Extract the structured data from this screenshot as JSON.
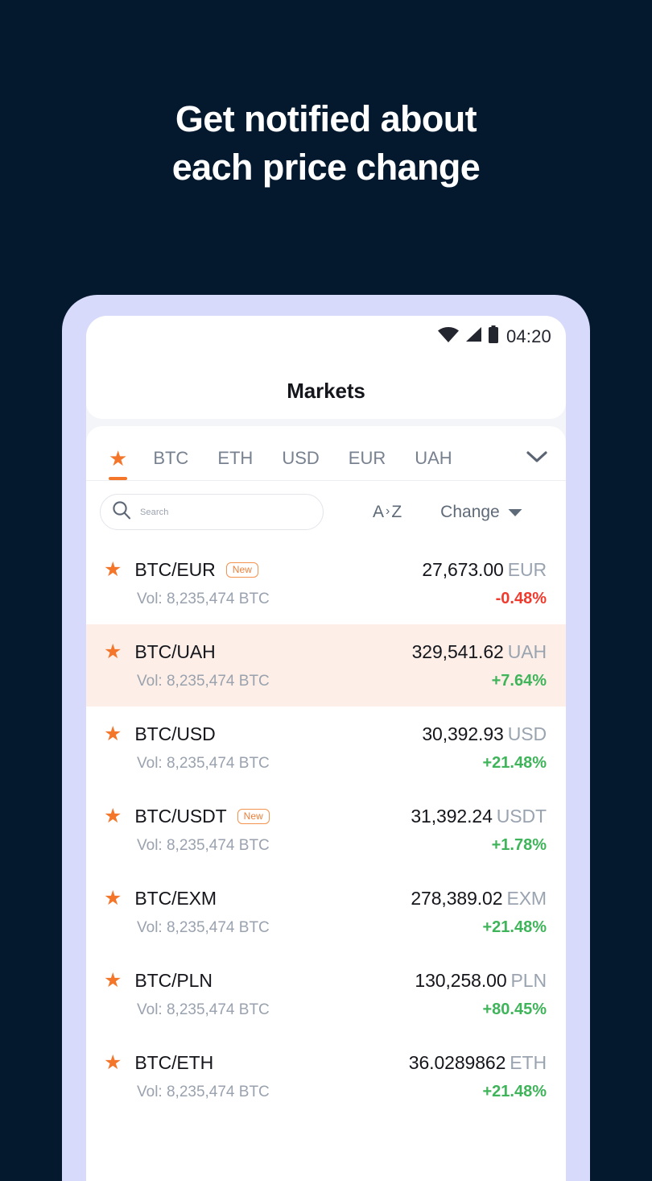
{
  "promo": {
    "line1": "Get notified about",
    "line2": "each price change"
  },
  "colors": {
    "background": "#04192e",
    "frame": "#d7dafa",
    "accent": "#f4762a",
    "up": "#3fb45a",
    "down": "#ef3b2d",
    "highlight_row": "#fdefe7"
  },
  "status_bar": {
    "time": "04:20",
    "icons": [
      "wifi-icon",
      "signal-icon",
      "battery-icon"
    ]
  },
  "header": {
    "title": "Markets"
  },
  "tabs": {
    "items": [
      {
        "label": "★",
        "name": "favorites",
        "active": true
      },
      {
        "label": "BTC",
        "name": "btc",
        "active": false
      },
      {
        "label": "ETH",
        "name": "eth",
        "active": false
      },
      {
        "label": "USD",
        "name": "usd",
        "active": false
      },
      {
        "label": "EUR",
        "name": "eur",
        "active": false
      },
      {
        "label": "UAH",
        "name": "uah",
        "active": false
      }
    ],
    "expand_icon": "chevron-down-icon"
  },
  "search": {
    "placeholder": "Search",
    "value": "",
    "icon": "search-icon"
  },
  "sort": {
    "alpha_label_a": "A",
    "alpha_sep": "›",
    "alpha_label_z": "Z",
    "change_label": "Change",
    "change_caret": "caret-down-icon"
  },
  "markets": [
    {
      "pair": "BTC/EUR",
      "badge": "New",
      "volume": "Vol: 8,235,474 BTC",
      "price": "27,673.00",
      "currency": "EUR",
      "change": "-0.48%",
      "direction": "down",
      "highlight": false
    },
    {
      "pair": "BTC/UAH",
      "badge": "",
      "volume": "Vol: 8,235,474 BTC",
      "price": "329,541.62",
      "currency": "UAH",
      "change": "+7.64%",
      "direction": "up",
      "highlight": true
    },
    {
      "pair": "BTC/USD",
      "badge": "",
      "volume": "Vol: 8,235,474 BTC",
      "price": "30,392.93",
      "currency": "USD",
      "change": "+21.48%",
      "direction": "up",
      "highlight": false
    },
    {
      "pair": "BTC/USDT",
      "badge": "New",
      "volume": "Vol: 8,235,474 BTC",
      "price": "31,392.24",
      "currency": "USDT",
      "change": "+1.78%",
      "direction": "up",
      "highlight": false
    },
    {
      "pair": "BTC/EXM",
      "badge": "",
      "volume": "Vol: 8,235,474 BTC",
      "price": "278,389.02",
      "currency": "EXM",
      "change": "+21.48%",
      "direction": "up",
      "highlight": false
    },
    {
      "pair": "BTC/PLN",
      "badge": "",
      "volume": "Vol: 8,235,474 BTC",
      "price": "130,258.00",
      "currency": "PLN",
      "change": "+80.45%",
      "direction": "up",
      "highlight": false
    },
    {
      "pair": "BTC/ETH",
      "badge": "",
      "volume": "Vol: 8,235,474 BTC",
      "price": "36.0289862",
      "currency": "ETH",
      "change": "+21.48%",
      "direction": "up",
      "highlight": false
    }
  ]
}
